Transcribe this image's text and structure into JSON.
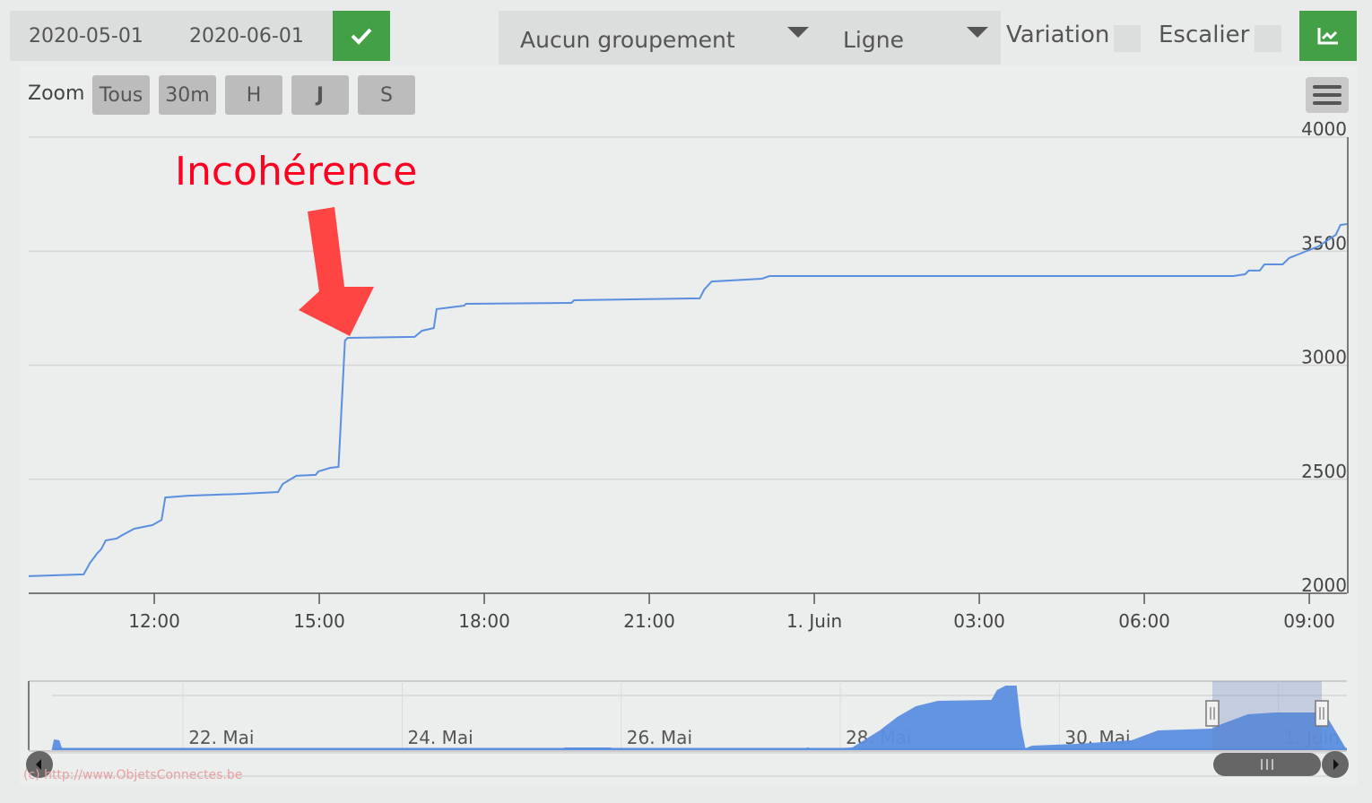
{
  "toolbar": {
    "date_from": "2020-05-01",
    "date_to": "2020-06-01",
    "grouping": "Aucun groupement",
    "chart_kind": "Ligne",
    "variation_label": "Variation",
    "stair_label": "Escalier",
    "variation_checked": false,
    "stair_checked": false,
    "accent": "#43a047"
  },
  "zoom": {
    "label": "Zoom",
    "buttons": [
      "Tous",
      "30m",
      "H",
      "J",
      "S"
    ]
  },
  "annotation": {
    "text": "Incohérence",
    "color": "#ff0020",
    "arrow_color": "#ff4444"
  },
  "watermark": "(c) http://www.ObjetsConnectes.be",
  "chart_data": {
    "type": "line",
    "title": "",
    "xlabel": "",
    "ylabel": "",
    "grid": true,
    "series_color": "#5b8fe0",
    "xlim": [
      "2020-05-31T09:43",
      "2020-06-01T09:41"
    ],
    "ylim": [
      2000,
      4000
    ],
    "yticks": [
      2000,
      2500,
      3000,
      3500,
      4000
    ],
    "xticks": [
      {
        "t": "2020-05-31T12:00",
        "label": "12:00"
      },
      {
        "t": "2020-05-31T15:00",
        "label": "15:00"
      },
      {
        "t": "2020-05-31T18:00",
        "label": "18:00"
      },
      {
        "t": "2020-05-31T21:00",
        "label": "21:00"
      },
      {
        "t": "2020-06-01T00:00",
        "label": "1. Juin"
      },
      {
        "t": "2020-06-01T03:00",
        "label": "03:00"
      },
      {
        "t": "2020-06-01T06:00",
        "label": "06:00"
      },
      {
        "t": "2020-06-01T09:00",
        "label": "09:00"
      }
    ],
    "series": [
      {
        "points": [
          [
            "2020-05-31T09:43",
            2075
          ],
          [
            "2020-05-31T10:43",
            2083
          ],
          [
            "2020-05-31T10:50",
            2134
          ],
          [
            "2020-05-31T10:58",
            2177
          ],
          [
            "2020-05-31T11:02",
            2193
          ],
          [
            "2020-05-31T11:07",
            2232
          ],
          [
            "2020-05-31T11:19",
            2240
          ],
          [
            "2020-05-31T11:25",
            2255
          ],
          [
            "2020-05-31T11:38",
            2283
          ],
          [
            "2020-05-31T11:58",
            2299
          ],
          [
            "2020-05-31T12:08",
            2322
          ],
          [
            "2020-05-31T12:12",
            2420
          ],
          [
            "2020-05-31T12:37",
            2428
          ],
          [
            "2020-05-31T13:36",
            2436
          ],
          [
            "2020-05-31T14:15",
            2444
          ],
          [
            "2020-05-31T14:20",
            2479
          ],
          [
            "2020-05-31T14:35",
            2515
          ],
          [
            "2020-05-31T14:56",
            2519
          ],
          [
            "2020-05-31T14:59",
            2534
          ],
          [
            "2020-05-31T15:12",
            2550
          ],
          [
            "2020-05-31T15:21",
            2554
          ],
          [
            "2020-05-31T15:28",
            3108
          ],
          [
            "2020-05-31T15:31",
            3120
          ],
          [
            "2020-05-31T16:44",
            3124
          ],
          [
            "2020-05-31T16:52",
            3151
          ],
          [
            "2020-05-31T17:05",
            3163
          ],
          [
            "2020-05-31T17:08",
            3246
          ],
          [
            "2020-05-31T17:38",
            3261
          ],
          [
            "2020-05-31T17:40",
            3269
          ],
          [
            "2020-05-31T19:35",
            3273
          ],
          [
            "2020-05-31T19:38",
            3285
          ],
          [
            "2020-05-31T21:55",
            3293
          ],
          [
            "2020-05-31T22:00",
            3332
          ],
          [
            "2020-05-31T22:08",
            3367
          ],
          [
            "2020-05-31T23:03",
            3379
          ],
          [
            "2020-05-31T23:11",
            3391
          ],
          [
            "2020-06-01T07:37",
            3391
          ],
          [
            "2020-06-01T07:50",
            3399
          ],
          [
            "2020-06-01T07:54",
            3415
          ],
          [
            "2020-06-01T08:06",
            3415
          ],
          [
            "2020-06-01T08:11",
            3442
          ],
          [
            "2020-06-01T08:31",
            3442
          ],
          [
            "2020-06-01T08:38",
            3470
          ],
          [
            "2020-06-01T08:50",
            3489
          ],
          [
            "2020-06-01T09:10",
            3521
          ],
          [
            "2020-06-01T09:29",
            3572
          ],
          [
            "2020-06-01T09:34",
            3615
          ],
          [
            "2020-06-01T09:41",
            3619
          ]
        ]
      }
    ],
    "navigator": {
      "xlim": [
        "2020-05-20T14:10",
        "2020-06-01T15:00"
      ],
      "xticks": [
        {
          "t": "2020-05-22T00:00",
          "label": "22. Mai"
        },
        {
          "t": "2020-05-24T00:00",
          "label": "24. Mai"
        },
        {
          "t": "2020-05-26T00:00",
          "label": "26. Mai"
        },
        {
          "t": "2020-05-28T00:00",
          "label": "28. Mai"
        },
        {
          "t": "2020-05-30T00:00",
          "label": "30. Mai"
        },
        {
          "t": "2020-06-01T00:00",
          "label": "1. Juin"
        }
      ],
      "selection": [
        "2020-05-31T09:43",
        "2020-06-01T09:41"
      ],
      "points": [
        [
          "2020-05-20T19:12",
          0
        ],
        [
          "2020-05-20T19:41",
          600
        ],
        [
          "2020-05-20T20:53",
          550
        ],
        [
          "2020-05-20T21:36",
          0
        ],
        [
          "2020-05-25T08:53",
          0
        ],
        [
          "2020-05-25T11:46",
          150
        ],
        [
          "2020-05-25T21:36",
          150
        ],
        [
          "2020-05-25T23:31",
          0
        ],
        [
          "2020-05-27T14:53",
          0
        ],
        [
          "2020-05-27T16:48",
          150
        ],
        [
          "2020-05-27T18:58",
          50
        ],
        [
          "2020-05-28T02:38",
          150
        ],
        [
          "2020-05-28T08:38",
          1100
        ],
        [
          "2020-05-28T12:29",
          1850
        ],
        [
          "2020-05-28T16:34",
          2450
        ],
        [
          "2020-05-28T21:22",
          2750
        ],
        [
          "2020-05-29T09:07",
          2800
        ],
        [
          "2020-05-29T10:19",
          3350
        ],
        [
          "2020-05-29T12:14",
          3600
        ],
        [
          "2020-05-29T14:38",
          3600
        ],
        [
          "2020-05-29T15:36",
          1350
        ],
        [
          "2020-05-29T16:34",
          100
        ],
        [
          "2020-05-29T18:00",
          250
        ],
        [
          "2020-05-30T03:50",
          350
        ],
        [
          "2020-05-30T15:50",
          550
        ],
        [
          "2020-05-30T21:36",
          1100
        ],
        [
          "2020-05-31T09:22",
          1200
        ],
        [
          "2020-05-31T11:31",
          1450
        ],
        [
          "2020-05-31T17:17",
          2000
        ],
        [
          "2020-05-31T23:17",
          2100
        ],
        [
          "2020-06-01T10:05",
          2100
        ]
      ]
    }
  }
}
